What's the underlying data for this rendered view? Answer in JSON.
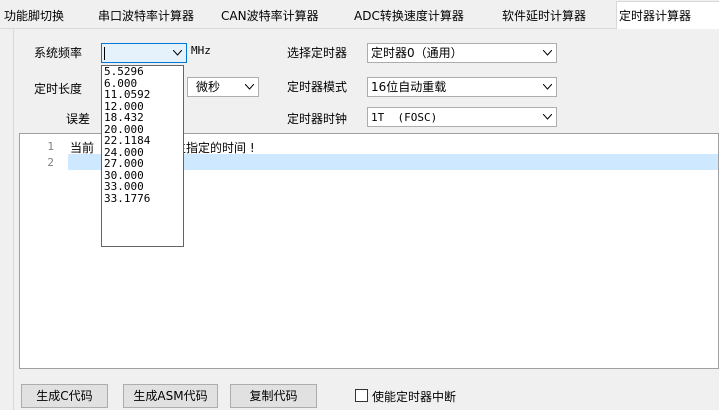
{
  "tabs": [
    {
      "label": "功能脚切换"
    },
    {
      "label": "串口波特率计算器"
    },
    {
      "label": "CAN波特率计算器"
    },
    {
      "label": "ADC转换速度计算器"
    },
    {
      "label": "软件延时计算器"
    },
    {
      "label": "定时器计算器"
    }
  ],
  "form": {
    "freq_label": "系统频率",
    "freq_value": "",
    "freq_unit": "MHz",
    "length_label": "定时长度",
    "length_unit": "微秒",
    "error_label": "误差",
    "timer_select_label": "选择定时器",
    "timer_select_value": "定时器0（通用）",
    "timer_mode_label": "定时器模式",
    "timer_mode_value": "16位自动重载",
    "timer_clock_label": "定时器时钟",
    "timer_clock_value": "1T  (FOSC)"
  },
  "freq_options": [
    "5.5296",
    "6.000",
    "11.0592",
    "12.000",
    "18.432",
    "20.000",
    "22.1184",
    "24.000",
    "27.000",
    "30.000",
    "33.000",
    "33.1776"
  ],
  "editor": {
    "line_numbers": [
      "1",
      "2"
    ],
    "line1_start": "当前",
    "line1_end": "生指定的时间 !"
  },
  "buttons": {
    "gen_c": "生成C代码",
    "gen_asm": "生成ASM代码",
    "copy": "复制代码"
  },
  "interrupt_checkbox_label": "使能定时器中断"
}
